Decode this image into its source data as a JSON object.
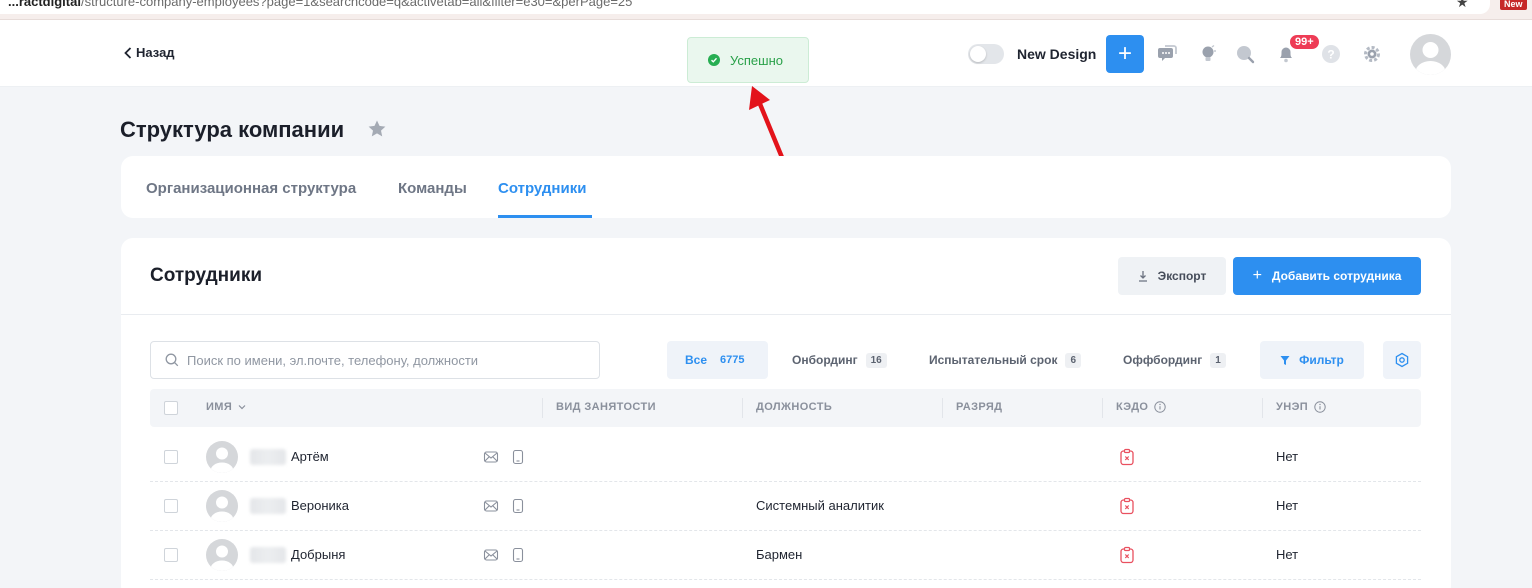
{
  "browser": {
    "url_bold": "...ractdigital",
    "url_rest": "/structure-company-employees?page=1&searchcode=q&activetab=all&filter=e30=&perPage=25",
    "new_badge": "New"
  },
  "topbar": {
    "back_label": "Назад",
    "toast_text": "Успешно",
    "new_design_label": "New Design",
    "notification_badge": "99+"
  },
  "page": {
    "title": "Структура компании",
    "tabs": [
      {
        "label": "Организационная структура",
        "active": false
      },
      {
        "label": "Команды",
        "active": false
      },
      {
        "label": "Сотрудники",
        "active": true
      }
    ]
  },
  "employees": {
    "title": "Сотрудники",
    "export_label": "Экспорт",
    "add_label": "Добавить сотрудника",
    "search_placeholder": "Поиск по имени, эл.почте, телефону, должности",
    "filters": [
      {
        "label": "Все",
        "count": "6775",
        "active": true
      },
      {
        "label": "Онбординг",
        "count": "16",
        "active": false
      },
      {
        "label": "Испытательный срок",
        "count": "6",
        "active": false
      },
      {
        "label": "Оффбординг",
        "count": "1",
        "active": false
      }
    ],
    "filter_button": "Фильтр",
    "columns": [
      "ИМЯ",
      "ВИД ЗАНЯТОСТИ",
      "ДОЛЖНОСТЬ",
      "РАЗРЯД",
      "КЭДО",
      "УНЭП"
    ],
    "rows": [
      {
        "name": "Артём",
        "employment": "",
        "position": "",
        "grade": "",
        "unep": "Нет"
      },
      {
        "name": "Вероника",
        "employment": "",
        "position": "Системный аналитик",
        "grade": "",
        "unep": "Нет"
      },
      {
        "name": "Добрыня",
        "employment": "",
        "position": "Бармен",
        "grade": "",
        "unep": "Нет"
      }
    ]
  },
  "colors": {
    "accent": "#2d8ff0",
    "success": "#27ae52",
    "badge": "#ee3c56",
    "arrow": "#e3131b"
  }
}
